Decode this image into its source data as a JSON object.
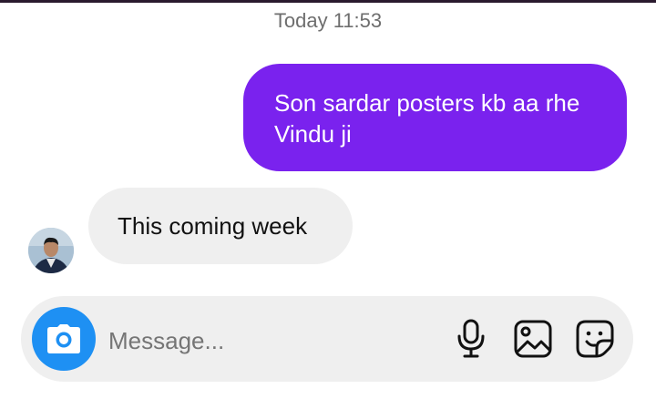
{
  "thread": {
    "timestamp": "Today 11:53",
    "messages": [
      {
        "direction": "outgoing",
        "text": "Son sardar posters kb aa rhe Vindu ji"
      },
      {
        "direction": "incoming",
        "text": "This coming week"
      }
    ]
  },
  "composer": {
    "placeholder": "Message...",
    "icons": [
      "camera-icon",
      "microphone-icon",
      "gallery-icon",
      "sticker-icon"
    ]
  },
  "colors": {
    "outgoing_bubble": "#7a22ee",
    "incoming_bubble": "#efefef",
    "camera_button": "#1e90f3"
  }
}
